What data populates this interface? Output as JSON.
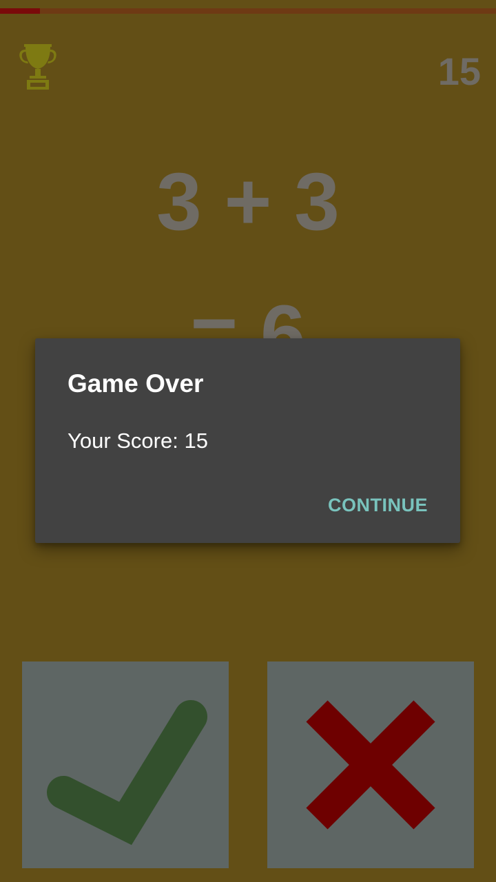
{
  "game": {
    "score": "15",
    "equation": "3 + 3",
    "result": "= 6",
    "timer_remaining_fraction": 0.08
  },
  "dialog": {
    "title": "Game Over",
    "message": "Your Score: 15",
    "continue_label": "CONTINUE"
  },
  "buttons": {
    "correct_icon": "checkmark-icon",
    "wrong_icon": "cross-icon"
  },
  "colors": {
    "background": "#634f16",
    "dialog": "#424242",
    "accent": "#79c3bd",
    "check": "#33502d",
    "cross": "#6e0000"
  }
}
